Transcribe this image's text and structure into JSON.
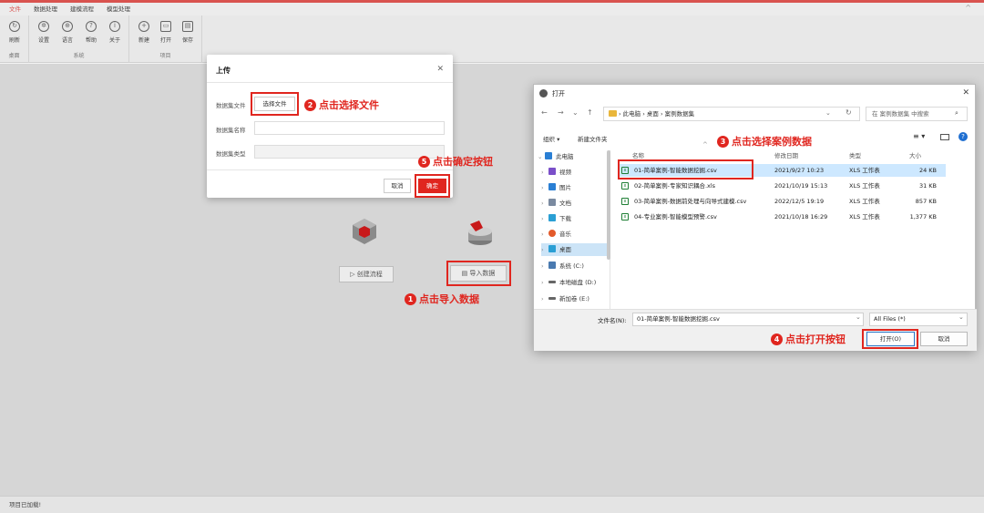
{
  "menu": {
    "items": [
      "文件",
      "数据处理",
      "建模流程",
      "模型处理"
    ],
    "active_index": 0
  },
  "ribbon": {
    "groups": [
      {
        "label": "桌面",
        "buttons": [
          {
            "label": "刷新",
            "icon": "refresh-icon"
          }
        ]
      },
      {
        "label": "系统",
        "buttons": [
          {
            "label": "设置",
            "icon": "gear-icon"
          },
          {
            "label": "语言",
            "icon": "globe-icon"
          },
          {
            "label": "帮助",
            "icon": "help-icon"
          },
          {
            "label": "关于",
            "icon": "info-icon"
          }
        ]
      },
      {
        "label": "项目",
        "buttons": [
          {
            "label": "新建",
            "icon": "plus-icon"
          },
          {
            "label": "打开",
            "icon": "folder-icon"
          },
          {
            "label": "保存",
            "icon": "save-icon"
          }
        ]
      }
    ]
  },
  "workspace": {
    "create_flow_label": "▷ 创建流程",
    "import_data_label": "▤ 导入数据"
  },
  "status": {
    "text": "项目已加载!"
  },
  "upload_dialog": {
    "title": "上传",
    "fields": [
      {
        "label": "数据集文件",
        "button": "选择文件"
      },
      {
        "label": "数据集名称",
        "value": ""
      },
      {
        "label": "数据集类型",
        "value": ""
      }
    ],
    "cancel": "取消",
    "confirm": "确定"
  },
  "open_dialog": {
    "title": "打开",
    "breadcrumb": "› 此电脑 › 桌面 › 案例数据集",
    "search_placeholder": "在 案例数据集 中搜索",
    "toolbar": {
      "organize": "组织 ▾",
      "new_folder": "新建文件夹"
    },
    "columns": {
      "name": "名称",
      "date": "修改日期",
      "type": "类型",
      "size": "大小"
    },
    "sidebar": [
      {
        "label": "此电脑",
        "color": "#2a7fd4",
        "expanded": true
      },
      {
        "label": "视频",
        "color": "#7a4fc9"
      },
      {
        "label": "图片",
        "color": "#2a7fd4"
      },
      {
        "label": "文档",
        "color": "#7a8aa0"
      },
      {
        "label": "下载",
        "color": "#2a9fd4"
      },
      {
        "label": "音乐",
        "color": "#e35a2a"
      },
      {
        "label": "桌面",
        "color": "#2a9fd4",
        "selected": true
      },
      {
        "label": "系统 (C:)",
        "color": "#4a7ab0"
      },
      {
        "label": "本地磁盘 (D:)",
        "color": "#666666"
      },
      {
        "label": "新加卷 (E:)",
        "color": "#666666"
      }
    ],
    "files": [
      {
        "name": "01-简单案例-智能数据挖掘.csv",
        "date": "2021/9/27 10:23",
        "type": "XLS 工作表",
        "size": "24 KB",
        "selected": true
      },
      {
        "name": "02-简单案例-专家知识耦合.xls",
        "date": "2021/10/19 15:13",
        "type": "XLS 工作表",
        "size": "31 KB"
      },
      {
        "name": "03-简单案例-数据前处理与向导式建模.csv",
        "date": "2022/12/5 19:19",
        "type": "XLS 工作表",
        "size": "857 KB"
      },
      {
        "name": "04-专业案例-智能模型预警.csv",
        "date": "2021/10/18 16:29",
        "type": "XLS 工作表",
        "size": "1,377 KB"
      }
    ],
    "filename_label": "文件名(N):",
    "filename_value": "01-简单案例-智能数据挖掘.csv",
    "filter_value": "All Files (*)",
    "open_button": "打开(O)",
    "cancel_button": "取消"
  },
  "annotations": {
    "a1": {
      "num": "1",
      "text": "点击导入数据"
    },
    "a2": {
      "num": "2",
      "text": "点击选择文件"
    },
    "a3": {
      "num": "3",
      "text": "点击选择案例数据"
    },
    "a4": {
      "num": "4",
      "text": "点击打开按钮"
    },
    "a5": {
      "num": "5",
      "text": "点击确定按钮"
    }
  },
  "colors": {
    "accent": "#e0261f",
    "selection": "#cde8ff"
  }
}
